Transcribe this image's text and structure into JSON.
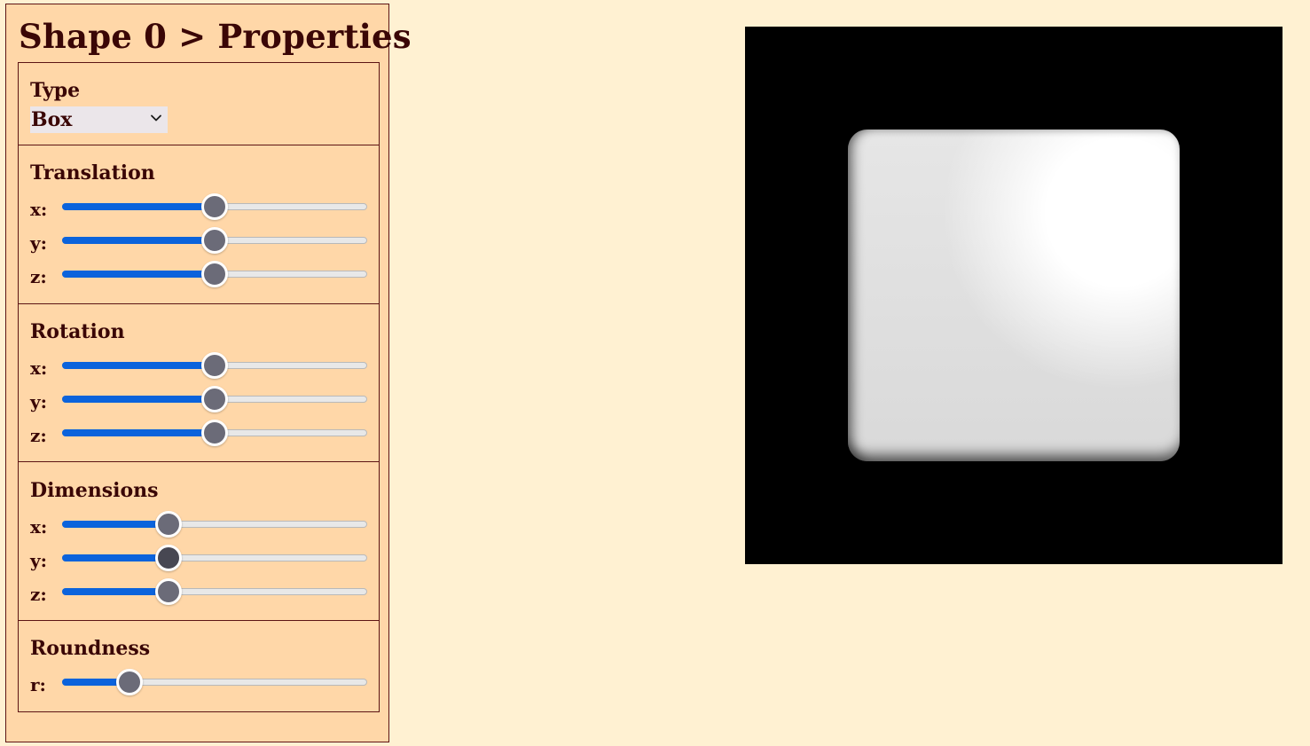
{
  "panel": {
    "title": "Shape 0 > Properties"
  },
  "type_section": {
    "title": "Type",
    "selected": "Box"
  },
  "translation": {
    "title": "Translation",
    "rows": [
      {
        "label": "x:",
        "value_fraction": 0.5
      },
      {
        "label": "y:",
        "value_fraction": 0.5
      },
      {
        "label": "z:",
        "value_fraction": 0.5
      }
    ]
  },
  "rotation": {
    "title": "Rotation",
    "rows": [
      {
        "label": "x:",
        "value_fraction": 0.5
      },
      {
        "label": "y:",
        "value_fraction": 0.5
      },
      {
        "label": "z:",
        "value_fraction": 0.5
      }
    ]
  },
  "dimensions": {
    "title": "Dimensions",
    "rows": [
      {
        "label": "x:",
        "value_fraction": 0.35
      },
      {
        "label": "y:",
        "value_fraction": 0.35
      },
      {
        "label": "z:",
        "value_fraction": 0.35
      }
    ]
  },
  "roundness": {
    "title": "Roundness",
    "rows": [
      {
        "label": "r:",
        "value_fraction": 0.22
      }
    ]
  },
  "colors": {
    "page_background": "#fff1d2",
    "panel_background": "#ffd7a8",
    "border": "#5c1414",
    "text": "#3a0606",
    "slider_fill": "#0b63dc",
    "slider_thumb": "#6b6b78",
    "viewport_background": "#000000"
  },
  "icons": {
    "select_arrow": "chevron-down-icon"
  }
}
